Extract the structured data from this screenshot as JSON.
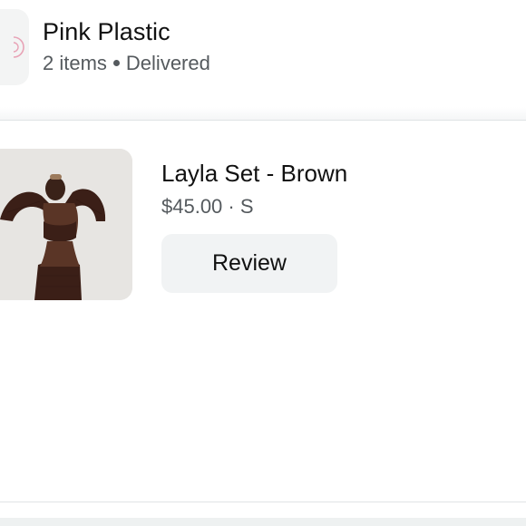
{
  "store": {
    "name": "Pink Plastic",
    "item_count": "2 items",
    "status": "Delivered"
  },
  "item": {
    "title": "Layla Set - Brown",
    "price": "$45.00",
    "separator": "·",
    "size": "S",
    "review_label": "Review",
    "image_icon": "product-photo"
  },
  "colors": {
    "text_primary": "#111111",
    "text_secondary": "#555a5e",
    "button_bg": "#f1f3f4",
    "brand_logo_accent": "#e8a3b6"
  }
}
